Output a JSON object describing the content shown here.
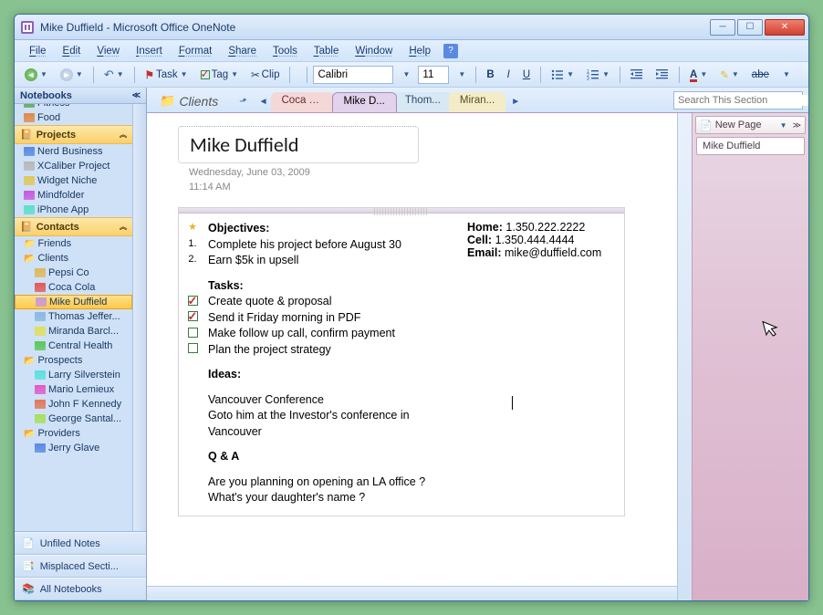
{
  "window": {
    "title": "Mike Duffield - Microsoft Office OneNote"
  },
  "menus": [
    "File",
    "Edit",
    "View",
    "Insert",
    "Format",
    "Share",
    "Tools",
    "Table",
    "Window",
    "Help"
  ],
  "toolbar": {
    "task": "Task",
    "tag": "Tag",
    "clip": "Clip",
    "font": "Calibri",
    "size": "11"
  },
  "nav": {
    "header": "Notebooks",
    "top_items": [
      {
        "label": "Fitness",
        "color": "#5aa85a",
        "depth": 1
      },
      {
        "label": "Food",
        "color": "#e08a4a",
        "depth": 1
      }
    ],
    "projects": {
      "label": "Projects",
      "items": [
        {
          "label": "Nerd Business",
          "color": "#5a8ae0",
          "depth": 1
        },
        {
          "label": "XCaliber Project",
          "color": "#b8b8b8",
          "depth": 1
        },
        {
          "label": "Widget Niche",
          "color": "#e0c85a",
          "depth": 1
        },
        {
          "label": "Mindfolder",
          "color": "#c85ae0",
          "depth": 1
        },
        {
          "label": "iPhone App",
          "color": "#5ae0c8",
          "depth": 1
        }
      ]
    },
    "contacts": {
      "label": "Contacts",
      "items": [
        {
          "label": "Friends",
          "color": "#5a8ae0",
          "depth": 1,
          "icon": "folder"
        },
        {
          "label": "Clients",
          "color": "#b8b8b8",
          "depth": 1,
          "icon": "folder-open",
          "children": [
            {
              "label": "Pepsi Co",
              "color": "#e0b85a",
              "depth": 2
            },
            {
              "label": "Coca Cola",
              "color": "#e05a5a",
              "depth": 2
            },
            {
              "label": "Mike Duffield",
              "color": "#c898d8",
              "depth": 2,
              "selected": true
            },
            {
              "label": "Thomas Jeffer...",
              "color": "#8ab8e0",
              "depth": 2
            },
            {
              "label": "Miranda Barcl...",
              "color": "#e0e05a",
              "depth": 2
            },
            {
              "label": "Central Health",
              "color": "#5ac85a",
              "depth": 2
            }
          ]
        },
        {
          "label": "Prospects",
          "color": "#b8b8b8",
          "depth": 1,
          "icon": "folder-open",
          "children": [
            {
              "label": "Larry Silverstein",
              "color": "#5ae0e0",
              "depth": 2
            },
            {
              "label": "Mario Lemieux",
              "color": "#e05ac8",
              "depth": 2
            },
            {
              "label": "John F Kennedy",
              "color": "#e0785a",
              "depth": 2
            },
            {
              "label": "George Santal...",
              "color": "#a8e05a",
              "depth": 2
            }
          ]
        },
        {
          "label": "Providers",
          "color": "#b8b8b8",
          "depth": 1,
          "icon": "folder-open",
          "children": [
            {
              "label": "Jerry Glave",
              "color": "#5a8ae0",
              "depth": 2
            }
          ]
        }
      ]
    },
    "footer": [
      "Unfiled Notes",
      "Misplaced Secti...",
      "All Notebooks"
    ]
  },
  "section_bar": {
    "label": "Clients",
    "tabs": [
      {
        "label": "Coca Cola",
        "cls": "t-red"
      },
      {
        "label": "Mike D...",
        "cls": "sel"
      },
      {
        "label": "Thom...",
        "cls": "t-blue"
      },
      {
        "label": "Miran...",
        "cls": "t-yel"
      }
    ],
    "search_placeholder": "Search This Section"
  },
  "page": {
    "title": "Mike Duffield",
    "date": "Wednesday, June 03, 2009",
    "time": "11:14 AM",
    "objectives_label": "Objectives:",
    "objectives": [
      "Complete his project before August 30",
      "Earn $5k in upsell"
    ],
    "tasks_label": "Tasks:",
    "tasks": [
      {
        "text": "Create quote & proposal",
        "done": true
      },
      {
        "text": "Send it Friday morning in PDF",
        "done": true
      },
      {
        "text": "Make follow up call, confirm payment",
        "done": false
      },
      {
        "text": "Plan the project strategy",
        "done": false
      }
    ],
    "ideas_label": "Ideas:",
    "ideas": [
      "Vancouver Conference",
      "Goto him at the Investor's conference in Vancouver"
    ],
    "qa_label": "Q & A",
    "qa": [
      "Are you planning on opening an LA office ?",
      "What's your daughter's name ?"
    ],
    "contact": {
      "home_l": "Home:",
      "home": "1.350.222.2222",
      "cell_l": "Cell:",
      "cell": "1.350.444.4444",
      "email_l": "Email:",
      "email": "mike@duffield.com"
    }
  },
  "pagepanel": {
    "newpage": "New Page",
    "pages": [
      "Mike Duffield"
    ]
  }
}
